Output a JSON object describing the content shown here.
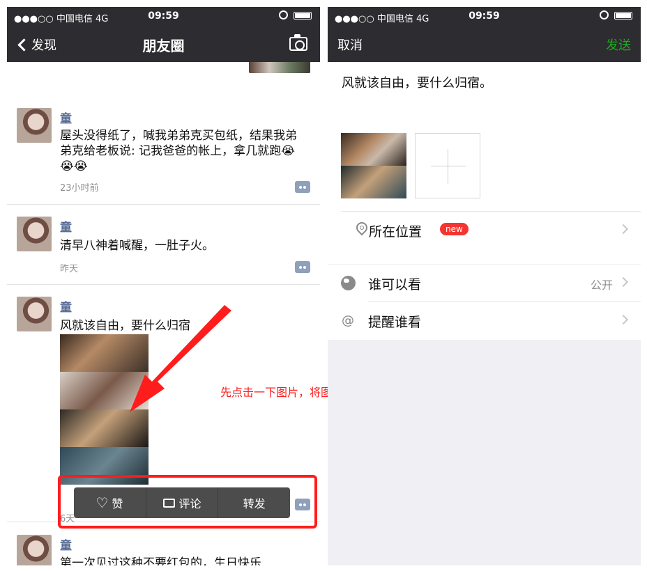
{
  "status_bar": {
    "signal": "●●●○○ 中国电信  4G",
    "time": "09:59"
  },
  "left": {
    "nav": {
      "back_label": "发现",
      "title": "朋友圈",
      "camera_icon": "camera-icon"
    },
    "posts": [
      {
        "name": "童",
        "text": "屋头没得纸了，喊我弟弟克买包纸，结果我弟弟克给老板说: 记我爸爸的帐上，拿几就跑😭😭😭",
        "time": "23小时前"
      },
      {
        "name": "童",
        "text": "清早八神着喊醒，一肚子火。",
        "time": "昨天"
      },
      {
        "name": "童",
        "text": "风就该自由，要什么归宿",
        "time": "6天"
      },
      {
        "name": "童",
        "text": "第一次见过这种不要红包的，生日快乐"
      }
    ],
    "action_bar": {
      "like": "赞",
      "comment": "评论",
      "forward": "转发"
    },
    "annotation": "先点击一下图片，将图片缓存到本地再转发"
  },
  "right": {
    "nav": {
      "cancel": "取消",
      "send": "发送"
    },
    "compose_text": "风就该自由，要什么归宿。",
    "location": {
      "label": "所在位置",
      "badge": "new"
    },
    "visibility": {
      "label": "谁可以看",
      "value": "公开"
    },
    "mention": {
      "label": "提醒谁看",
      "icon": "@"
    }
  },
  "colors": {
    "accent_green": "#1aad19",
    "name_blue": "#576b95",
    "annotation_red": "#ff1c1c",
    "navbar": "#2d2c30"
  }
}
